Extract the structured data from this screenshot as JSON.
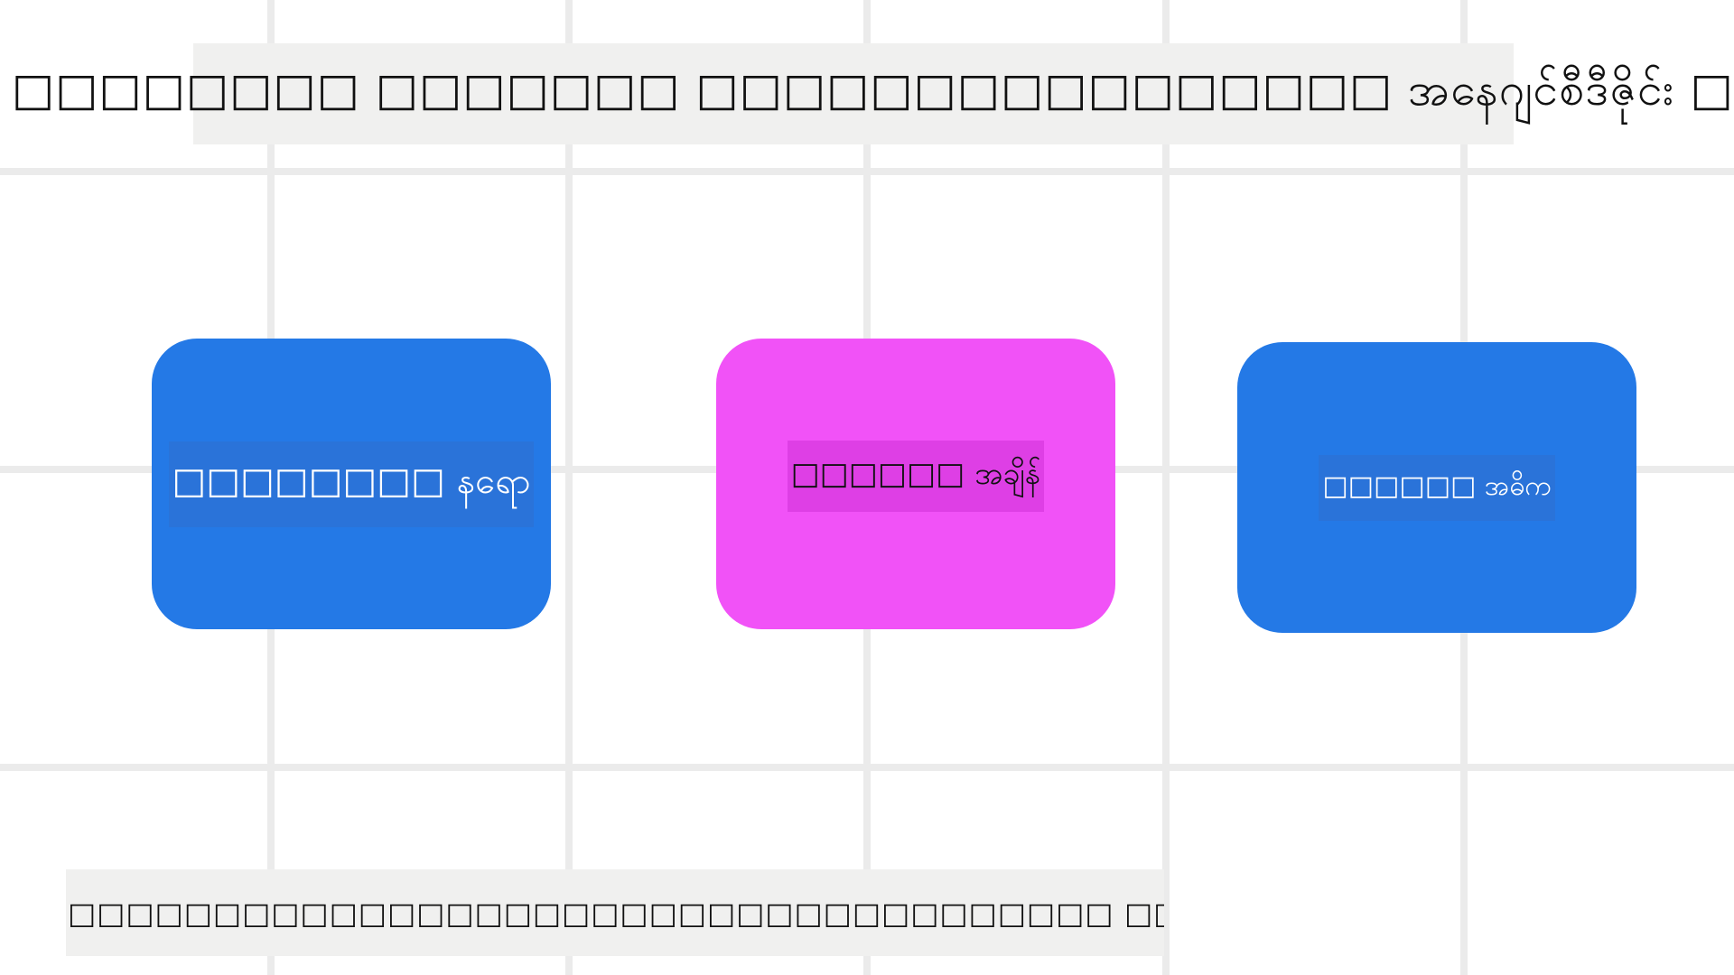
{
  "diagram": {
    "title": "□□□ □□□□□□□□ □□□□□□□ □□□□□□□□□□□□□□□□ အနေဂျင်စီဒီဇိုင်း □□များ",
    "nodes": [
      {
        "label": "□□□□□□□□ နရော",
        "color": "#2479e6"
      },
      {
        "label": "□□□□□□ အချိန်",
        "color": "#f152f7"
      },
      {
        "label": "□□□□□□ အဓိက",
        "color": "#2479e6"
      }
    ],
    "footer": "□□□□□□□□□□□□□□□□□□□□□□□□□□□□□□□□□□□□ □□□□□□□□□□□□□□□□□□□□□□□□□□□□□□□□□□□□"
  },
  "colors": {
    "background": "#ffffff",
    "grid": "#ebebeb",
    "label_bar": "#f0f0ef",
    "node_blue": "#2479e6",
    "node_magenta": "#f152f7"
  }
}
